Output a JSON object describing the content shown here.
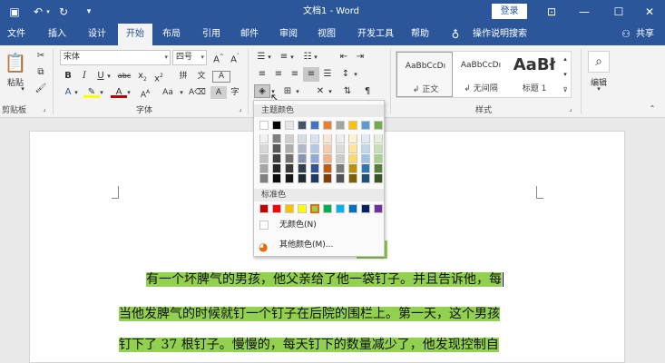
{
  "titlebar": {
    "doc_title": "文档1 - Word",
    "login_label": "登录"
  },
  "tabs": [
    "文件",
    "插入",
    "设计",
    "开始",
    "布局",
    "引用",
    "邮件",
    "审阅",
    "视图",
    "开发工具",
    "帮助"
  ],
  "tell_me": "操作说明搜索",
  "share": "共享",
  "ribbon": {
    "paste_label": "粘贴",
    "clipboard_label": "剪贴板",
    "font_group_label": "字体",
    "font_name": "宋体",
    "font_size": "四号",
    "styles_label": "样式",
    "edit_label": "编辑",
    "styles": [
      {
        "preview": "AaBbCcDı",
        "name": "↲ 正文"
      },
      {
        "preview": "AaBbCcDı",
        "name": "↲ 无间隔"
      },
      {
        "preview": "AaBł",
        "name": "标题 1"
      }
    ]
  },
  "popup": {
    "theme_header": "主题颜色",
    "standard_header": "标准色",
    "no_color": "无颜色(N)",
    "more_colors": "其他颜色(M)...",
    "theme_top": [
      "#ffffff",
      "#000000",
      "#e7e6e6",
      "#44546a",
      "#4472c4",
      "#ed7d31",
      "#a5a5a5",
      "#ffc000",
      "#5b9bd5",
      "#70ad47"
    ],
    "theme_shades": [
      [
        "#f2f2f2",
        "#7f7f7f",
        "#d0cece",
        "#d6dce4",
        "#d9e2f3",
        "#fbe5d5",
        "#ededed",
        "#fff2cc",
        "#deebf6",
        "#e2efd9"
      ],
      [
        "#d8d8d8",
        "#595959",
        "#aeabab",
        "#adb9ca",
        "#b4c6e7",
        "#f7cbac",
        "#dbdbdb",
        "#fee599",
        "#bdd7ee",
        "#c5e0b3"
      ],
      [
        "#bfbfbf",
        "#3f3f3f",
        "#757070",
        "#8496b0",
        "#8eaadb",
        "#f4b183",
        "#c9c9c9",
        "#ffd965",
        "#9cc3e5",
        "#a8d08d"
      ],
      [
        "#a5a5a5",
        "#262626",
        "#3a3838",
        "#323f4f",
        "#2f5496",
        "#c55a11",
        "#7b7b7b",
        "#bf9000",
        "#2e75b5",
        "#538135"
      ],
      [
        "#7f7f7f",
        "#0c0c0c",
        "#171616",
        "#222a35",
        "#1f3864",
        "#833c0b",
        "#525252",
        "#7f6000",
        "#1e4e79",
        "#375623"
      ]
    ],
    "standard": [
      "#c00000",
      "#ff0000",
      "#ffc000",
      "#ffff00",
      "#92d050",
      "#00b050",
      "#00b0f0",
      "#0070c0",
      "#002060",
      "#7030a0"
    ]
  },
  "document": {
    "lines": [
      "有一个坏脾气的男孩，他父亲给了他一袋钉子。并且告诉他，每",
      "当他发脾气的时候就钉一个钉子在后院的围栏上。第一天，这个男孩",
      "钉下了 37 根钉子。慢慢的，每天钉下的数量减少了，他发现控制自"
    ],
    "highlight_color": "#92d050"
  }
}
